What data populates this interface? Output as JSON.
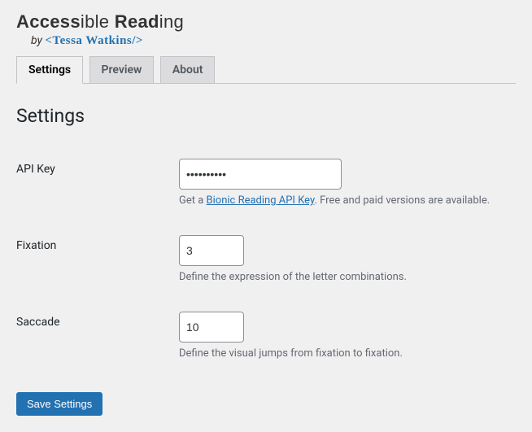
{
  "logo": {
    "title_parts": {
      "p1": "Access",
      "p2": "ib",
      "p3": "le ",
      "p4": "Read",
      "p5": "ing"
    },
    "byline_prefix": "by ",
    "byline_author": "<Tessa Watkins/>"
  },
  "tabs": [
    {
      "label": "Settings",
      "active": true
    },
    {
      "label": "Preview",
      "active": false
    },
    {
      "label": "About",
      "active": false
    }
  ],
  "heading": "Settings",
  "fields": {
    "api_key": {
      "label": "API Key",
      "value": "••••••••••",
      "help_prefix": "Get a ",
      "help_link": "Bionic Reading API Key",
      "help_suffix": ". Free and paid versions are available."
    },
    "fixation": {
      "label": "Fixation",
      "value": "3",
      "help": "Define the expression of the letter combinations."
    },
    "saccade": {
      "label": "Saccade",
      "value": "10",
      "help": "Define the visual jumps from fixation to fixation."
    }
  },
  "submit_label": "Save Settings"
}
